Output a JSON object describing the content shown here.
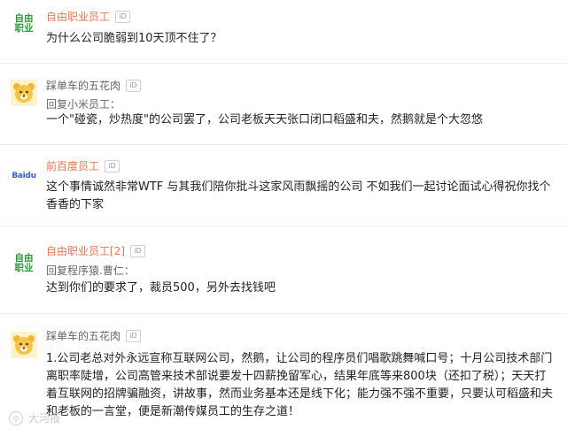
{
  "comments": [
    {
      "username": "自由职业员工",
      "id_badge": "iD",
      "avatar_lines": [
        "自由",
        "职业"
      ],
      "reply_to": "",
      "text": "为什么公司脆弱到10天顶不住了？"
    },
    {
      "username": "踩单车的五花肉",
      "id_badge": "iD",
      "reply_to": "回复小米员工：",
      "text": "一个\"碰瓷，炒热度\"的公司罢了，公司老板天天张口闭口稻盛和夫，然鹅就是个大忽悠"
    },
    {
      "username": "前百度员工",
      "id_badge": "iD",
      "avatar_text": "Baidu",
      "reply_to": "",
      "text": "这个事情诚然非常WTF 与其我们陪你批斗这家风雨飘摇的公司 不如我们一起讨论面试心得祝你找个香香的下家"
    },
    {
      "username": "自由职业员工[2]",
      "id_badge": "iD",
      "avatar_lines": [
        "自由",
        "职业"
      ],
      "reply_to": "回复程序猿.曹仁：",
      "text": "达到你们的要求了，裁员500，另外去找钱吧"
    },
    {
      "username": "踩单车的五花肉",
      "id_badge": "iD",
      "reply_to": "",
      "text": "1.公司老总对外永远宣称互联网公司，然鹅，让公司的程序员们唱歌跳舞喊口号；十月公司技术部门离职率陡增，公司高管来技术部说要发十四薪挽留军心，结果年底等来800块（还扣了税）；天天打着互联网的招牌骗融资，讲故事，然而业务基本还是线下化；能力强不强不重要，只要认可稻盛和夫和老板的一言堂，便是新潮传媒员工的生存之道！"
    }
  ],
  "watermark": "大河报",
  "colors": {
    "username_orange": "#eb7350",
    "username_gray": "#666666",
    "freelance_green": "#2e9b3a"
  }
}
